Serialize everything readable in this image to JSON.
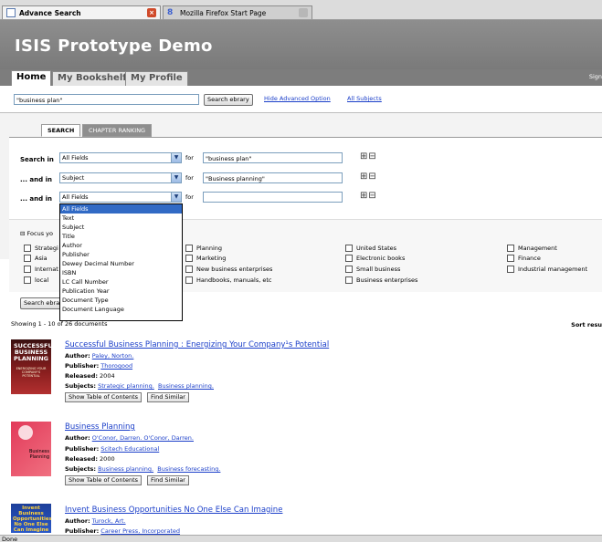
{
  "browser": {
    "tabs": [
      {
        "label": "Advance Search"
      },
      {
        "label": "Mozilla Firefox Start Page"
      }
    ],
    "status": "Done"
  },
  "header": {
    "title": "ISIS Prototype Demo",
    "nav": [
      {
        "label": "Home"
      },
      {
        "label": "My Bookshelf"
      },
      {
        "label": "My Profile"
      }
    ],
    "signin": "Sign"
  },
  "search": {
    "query": "\"business plan\"",
    "button": "Search ebrary",
    "hide_link": "Hide Advanced Option",
    "subjects_link": "All Subjects"
  },
  "panel": {
    "tabs": [
      {
        "label": "SEARCH"
      },
      {
        "label": "CHAPTER RANKING"
      }
    ],
    "rows": [
      {
        "label": "Search in",
        "field": "All Fields",
        "for": "for",
        "value": "\"business plan\""
      },
      {
        "label": "... and in",
        "field": "Subject",
        "for": "for",
        "value": "\"Business planning\""
      },
      {
        "label": "... and in",
        "field": "All Fields",
        "for": "for",
        "value": ""
      }
    ],
    "plus_minus": "⊞⊟"
  },
  "dropdown": {
    "options": [
      "All Fields",
      "Text",
      "Subject",
      "Title",
      "Author",
      "Publisher",
      "Dewey Decimal Number",
      "ISBN",
      "LC Call Number",
      "Publication Year",
      "Document Type",
      "Document Language"
    ],
    "selected_index": 0
  },
  "focus": {
    "title": "Focus yo",
    "col1": [
      "Strategi",
      "Asia",
      "Internat",
      "local"
    ],
    "col2": [
      "Planning",
      "Marketing",
      "New business enterprises",
      "Handbooks, manuals, etc"
    ],
    "col3": [
      "United States",
      "Electronic books",
      "Small business",
      "Business enterprises"
    ],
    "col4": [
      "Management",
      "Finance",
      "Industrial management"
    ],
    "button": "Search ebra"
  },
  "results": {
    "showing": "Showing 1 - 10 of 26 documents",
    "sort": "Sort resu",
    "author_label": "Author:",
    "publisher_label": "Publisher:",
    "released_label": "Released:",
    "subjects_label": "Subjects:",
    "toc_btn": "Show Table of Contents",
    "similar_btn": "Find Similar",
    "items": [
      {
        "title": "Successful Business Planning : Energizing Your Company¹s Potential",
        "author": "Paley, Norton.",
        "publisher": "Thorogood",
        "released": "2004",
        "subjects": [
          "Strategic planning.",
          "Business planning."
        ],
        "cover_text": "SUCCESSFUL BUSINESS PLANNING",
        "cover_sub": "ENERGIZING YOUR COMPANY'S POTENTIAL"
      },
      {
        "title": "Business Planning",
        "author": "O'Conor, Darren. O'Conor, Darren.",
        "publisher": "Scitech Educational",
        "released": "2000",
        "subjects": [
          "Business planning.",
          "Business forecasting."
        ],
        "cover_text": "Business Planning",
        "cover_sub": ""
      },
      {
        "title": "Invent Business Opportunities No One Else Can Imagine",
        "author": "Turock, Art.",
        "publisher": "Career Press, Incorporated",
        "released": "",
        "subjects": [],
        "cover_text": "Invent Business Opportunities No One Else Can Imagine",
        "cover_sub": ""
      }
    ]
  },
  "colors": {
    "header": "#868686",
    "link": "#1a3ec9",
    "dropdown_highlight": "#316ac5"
  }
}
